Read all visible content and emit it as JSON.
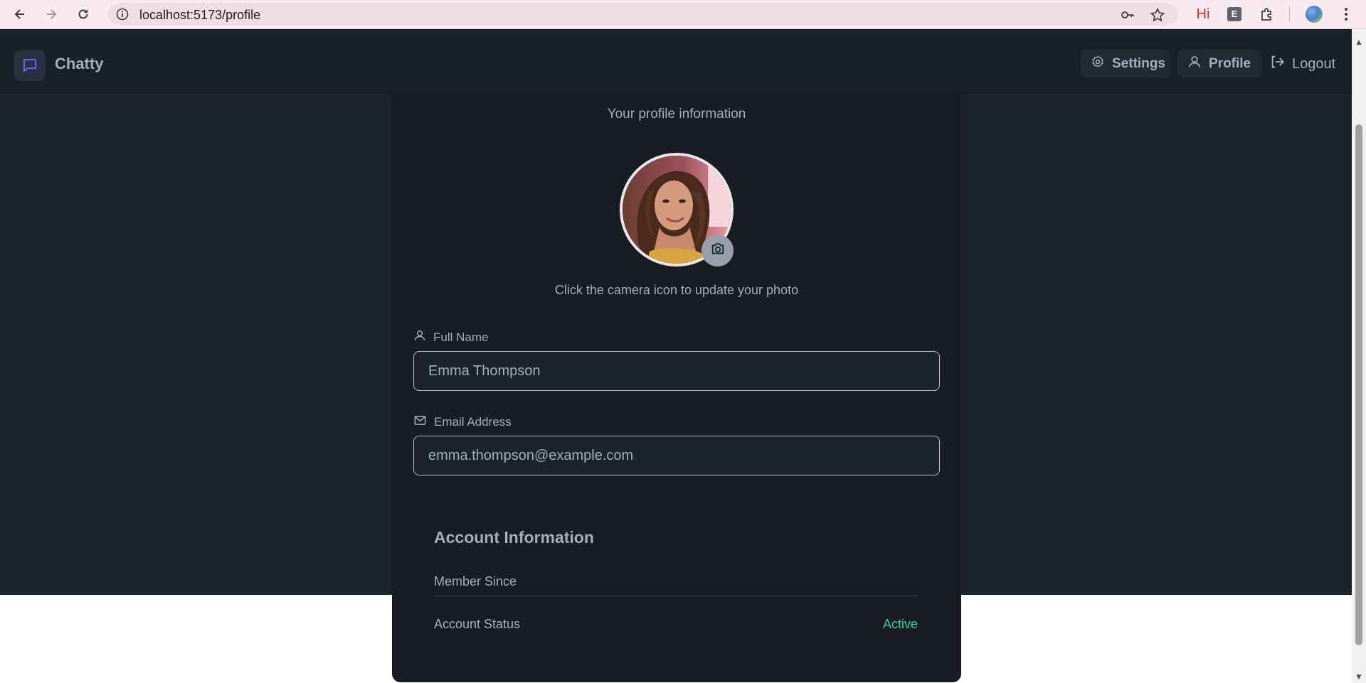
{
  "browser": {
    "url": "localhost:5173/profile",
    "extension_hi_label": "Hi",
    "extension_e_label": "E"
  },
  "header": {
    "app_name": "Chatty",
    "settings_label": "Settings",
    "profile_label": "Profile",
    "logout_label": "Logout",
    "accent_color": "#6366f1"
  },
  "profile": {
    "subtitle": "Your profile information",
    "photo_hint": "Click the camera icon to update your photo",
    "full_name_label": "Full Name",
    "full_name_value": "Emma Thompson",
    "email_label": "Email Address",
    "email_value": "emma.thompson@example.com"
  },
  "account": {
    "title": "Account Information",
    "member_since_label": "Member Since",
    "status_label": "Account Status",
    "status_value": "Active",
    "status_color": "#36d399"
  }
}
